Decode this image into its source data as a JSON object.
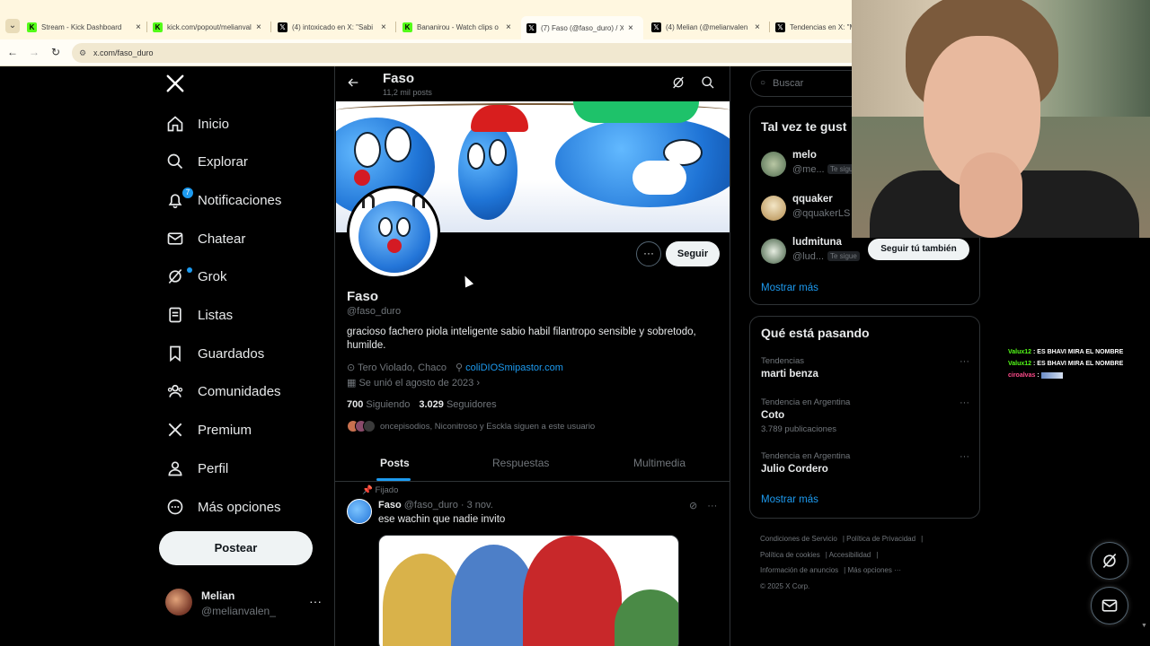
{
  "browser": {
    "tabs": [
      {
        "icon": "kick-icon",
        "title": "Stream - Kick Dashboard"
      },
      {
        "icon": "kick-icon",
        "title": "kick.com/popout/melianvalen/chat"
      },
      {
        "icon": "x-icon",
        "title": "(4) intoxicado en X: \"Sabi"
      },
      {
        "icon": "kick-icon",
        "title": "Bananirou - Watch clips o"
      },
      {
        "icon": "x-icon",
        "title": "(7) Faso (@faso_duro) / X"
      },
      {
        "icon": "x-icon",
        "title": "(4) Melian (@melianvalen"
      },
      {
        "icon": "x-icon",
        "title": "Tendencias en X: \"M"
      }
    ],
    "active_tab": 4,
    "url": "x.com/faso_duro"
  },
  "nav": {
    "logo": "X",
    "items": [
      {
        "label": "Inicio",
        "icon": "home-icon"
      },
      {
        "label": "Explorar",
        "icon": "search-icon"
      },
      {
        "label": "Notificaciones",
        "icon": "bell-icon",
        "badge": "7"
      },
      {
        "label": "Chatear",
        "icon": "mail-icon"
      },
      {
        "label": "Grok",
        "icon": "grok-icon"
      },
      {
        "label": "Listas",
        "icon": "list-icon"
      },
      {
        "label": "Guardados",
        "icon": "bookmark-icon"
      },
      {
        "label": "Comunidades",
        "icon": "people-icon"
      },
      {
        "label": "Premium",
        "icon": "x-icon"
      },
      {
        "label": "Perfil",
        "icon": "user-icon"
      },
      {
        "label": "Más opciones",
        "icon": "more-circle-icon"
      }
    ],
    "post_button": "Postear",
    "account": {
      "name": "Melian",
      "handle": "@melianvalen_",
      "more": "···"
    }
  },
  "profile": {
    "top_name": "Faso",
    "top_posts": "11,2 mil posts",
    "name": "Faso",
    "handle": "@faso_duro",
    "bio": "gracioso fachero piola inteligente sabio habil filantropo sensible y sobretodo, humilde.",
    "location": "Tero Violado, Chaco",
    "link": "coliDIOSmipastor.com",
    "joined": "Se unió el agosto de 2023",
    "following_count": "700",
    "following_label": "Siguiendo",
    "followers_count": "3.029",
    "followers_label": "Seguidores",
    "followed_by": "oncepisodios, Niconitroso y Esckla siguen a este usuario",
    "follow_button": "Seguir",
    "more_button": "···"
  },
  "tabs": {
    "items": [
      "Posts",
      "Respuestas",
      "Multimedia"
    ],
    "active": "Posts"
  },
  "post": {
    "pinned_label": "Fijado",
    "author": "Faso",
    "handle": "@faso_duro",
    "date": "· 3 nov.",
    "text": "ese wachin que nadie invito"
  },
  "right": {
    "search_placeholder": "Buscar",
    "who_to_follow": {
      "title": "Tal vez te gust",
      "users": [
        {
          "name": "melo",
          "handle": "@me...",
          "badge": "Te sigue"
        },
        {
          "name": "qquaker",
          "handle": "@qquakerLS",
          "badge": ""
        },
        {
          "name": "ludmituna",
          "handle": "@lud...",
          "badge": "Te sigue"
        }
      ],
      "show_more": "Mostrar más"
    },
    "trends": {
      "title": "Qué está pasando",
      "items": [
        {
          "context": "Tendencias",
          "title": "marti benza",
          "count": ""
        },
        {
          "context": "Tendencia en Argentina",
          "title": "Coto",
          "count": "3.789 publicaciones"
        },
        {
          "context": "Tendencia en Argentina",
          "title": "Julio Cordero",
          "count": ""
        }
      ],
      "show_more": "Mostrar más"
    },
    "footer": {
      "links": [
        "Condiciones de Servicio",
        "Política de Privacidad",
        "Política de cookies",
        "Accesibilidad",
        "Información de anuncios",
        "Más opciones ···"
      ],
      "copyright": "© 2025 X Corp."
    }
  },
  "overlay": {
    "follow_too_button": "Seguir tú también",
    "chat": [
      {
        "user": "Valux12",
        "message": ": ES BHAVI MIRA EL NOMBRE"
      },
      {
        "user": "Valux12",
        "message": ": ES BHAVI MIRA EL NOMBRE"
      },
      {
        "user": "ciroalvas",
        "message": ":"
      }
    ]
  },
  "colors": {
    "accent": "#1d9bf0",
    "background": "#000000",
    "text": "#e7e9ea",
    "muted": "#71767b",
    "kick_green": "#53fc18"
  }
}
